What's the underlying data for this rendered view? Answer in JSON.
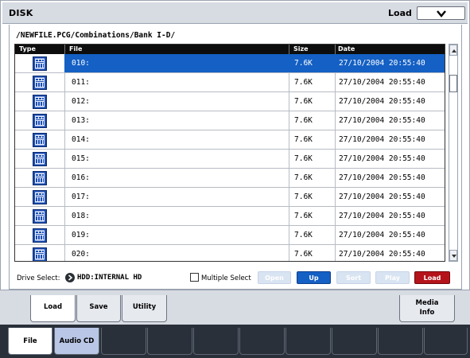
{
  "header": {
    "title": "DISK",
    "mode": "Load"
  },
  "path": "/NEWFILE.PCG/Combinations/Bank I-D/",
  "table": {
    "columns": [
      "Type",
      "File",
      "Size",
      "Date"
    ],
    "rows": [
      {
        "file": "010:",
        "size": "7.6K",
        "date": "27/10/2004 20:55:40",
        "selected": true
      },
      {
        "file": "011:",
        "size": "7.6K",
        "date": "27/10/2004 20:55:40"
      },
      {
        "file": "012:",
        "size": "7.6K",
        "date": "27/10/2004 20:55:40"
      },
      {
        "file": "013:",
        "size": "7.6K",
        "date": "27/10/2004 20:55:40"
      },
      {
        "file": "014:",
        "size": "7.6K",
        "date": "27/10/2004 20:55:40"
      },
      {
        "file": "015:",
        "size": "7.6K",
        "date": "27/10/2004 20:55:40"
      },
      {
        "file": "016:",
        "size": "7.6K",
        "date": "27/10/2004 20:55:40"
      },
      {
        "file": "017:",
        "size": "7.6K",
        "date": "27/10/2004 20:55:40"
      },
      {
        "file": "018:",
        "size": "7.6K",
        "date": "27/10/2004 20:55:40"
      },
      {
        "file": "019:",
        "size": "7.6K",
        "date": "27/10/2004 20:55:40"
      },
      {
        "file": "020:",
        "size": "7.6K",
        "date": "27/10/2004 20:55:40"
      }
    ],
    "row_icon": "combination-file-icon"
  },
  "controls": {
    "drive_select_label": "Drive Select:",
    "drive_value": "HDD:INTERNAL HD",
    "multiple_select_label": "Multiple Select",
    "multiple_select_checked": false,
    "open_label": "Open",
    "up_label": "Up",
    "sort_label": "Sort",
    "play_label": "Play",
    "load_label": "Load"
  },
  "subtabs": {
    "load": "Load",
    "save": "Save",
    "utility": "Utility",
    "media_info_line1": "Media",
    "media_info_line2": "Info",
    "active": "load"
  },
  "pagetabs": {
    "file": "File",
    "audio_cd": "Audio CD",
    "active": "file"
  },
  "colors": {
    "selection": "#1460c4",
    "load_button": "#b5131b",
    "header_bg": "#d7dbe2",
    "page_tab_bg": "#29303a"
  }
}
